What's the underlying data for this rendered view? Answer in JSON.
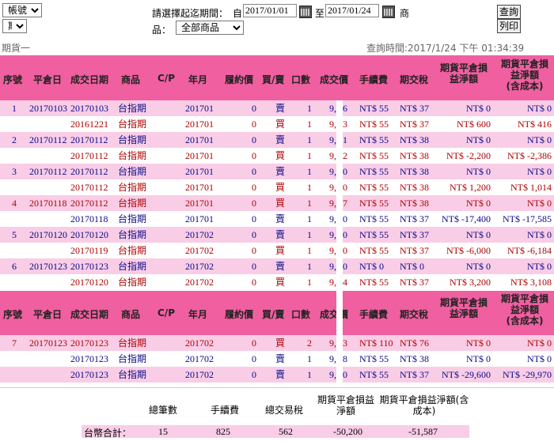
{
  "controls": {
    "account_select": "帳號",
    "type_select": "期貨-",
    "period_label": "請選擇起迄期間：",
    "from_label": "自",
    "from_date": "2017/01/01",
    "to_label": "至",
    "to_date": "2017/01/24",
    "product_label_1": "商",
    "product_label_2": "品：",
    "product_select": "全部商品",
    "query_button": "查詢",
    "print_button": "列印"
  },
  "subheader": {
    "section": "期貨一",
    "query_time": "查詢時間:2017/1/24 下午 01:34:39"
  },
  "columns": {
    "seq": "序號",
    "close_date": "平倉日",
    "trade_date": "成交日期",
    "product": "商品",
    "cp": "C/P",
    "month": "年月",
    "strike": "履約價",
    "side": "買/賣",
    "qty": "口數",
    "price": "成交價",
    "fee": "手續費",
    "tax": "期交稅",
    "pnl_net_1": "期貨平倉損",
    "pnl_net_2": "益淨額",
    "pnl_cost_1": "期貨平倉損",
    "pnl_cost_2": "益淨額",
    "pnl_cost_3": "(含成本)"
  },
  "rows1": [
    {
      "seq": "1",
      "close": "20170103",
      "date": "20170103",
      "product": "台指期",
      "month": "201701",
      "strike": "0",
      "side": "賣",
      "qty": "1",
      "price": "9,",
      "price2": "6",
      "fee": "NT$ 55",
      "tax": "NT$ 37",
      "net": "NT$ 0",
      "cost": "NT$ 0",
      "color": "blue"
    },
    {
      "seq": "",
      "close": "",
      "date": "20161221",
      "product": "台指期",
      "month": "201701",
      "strike": "0",
      "side": "買",
      "qty": "1",
      "price": "9,",
      "price2": "3",
      "fee": "NT$ 55",
      "tax": "NT$ 37",
      "net": "NT$ 600",
      "cost": "NT$ 416",
      "color": "red"
    },
    {
      "seq": "2",
      "close": "20170112",
      "date": "20170112",
      "product": "台指期",
      "month": "201701",
      "strike": "0",
      "side": "賣",
      "qty": "1",
      "price": "9,",
      "price2": "1",
      "fee": "NT$ 55",
      "tax": "NT$ 38",
      "net": "NT$ 0",
      "cost": "NT$ 0",
      "color": "blue"
    },
    {
      "seq": "",
      "close": "",
      "date": "20170112",
      "product": "台指期",
      "month": "201701",
      "strike": "0",
      "side": "買",
      "qty": "1",
      "price": "9,",
      "price2": "2",
      "fee": "NT$ 55",
      "tax": "NT$ 38",
      "net": "NT$ -2,200",
      "cost": "NT$ -2,386",
      "color": "red"
    },
    {
      "seq": "3",
      "close": "20170112",
      "date": "20170112",
      "product": "台指期",
      "month": "201701",
      "strike": "0",
      "side": "賣",
      "qty": "1",
      "price": "9,",
      "price2": "0",
      "fee": "NT$ 55",
      "tax": "NT$ 38",
      "net": "NT$ 0",
      "cost": "NT$ 0",
      "color": "blue"
    },
    {
      "seq": "",
      "close": "",
      "date": "20170112",
      "product": "台指期",
      "month": "201701",
      "strike": "0",
      "side": "買",
      "qty": "1",
      "price": "9,",
      "price2": "0",
      "fee": "NT$ 55",
      "tax": "NT$ 38",
      "net": "NT$ 1,200",
      "cost": "NT$ 1,014",
      "color": "red"
    },
    {
      "seq": "4",
      "close": "20170118",
      "date": "20170112",
      "product": "台指期",
      "month": "201701",
      "strike": "0",
      "side": "買",
      "qty": "1",
      "price": "9,",
      "price2": "7",
      "fee": "NT$ 55",
      "tax": "NT$ 38",
      "net": "NT$ 0",
      "cost": "NT$ 0",
      "color": "red"
    },
    {
      "seq": "",
      "close": "",
      "date": "20170118",
      "product": "台指期",
      "month": "201701",
      "strike": "0",
      "side": "賣",
      "qty": "1",
      "price": "9,",
      "price2": "0",
      "fee": "NT$ 55",
      "tax": "NT$ 37",
      "net": "NT$ -17,400",
      "cost": "NT$ -17,585",
      "color": "blue"
    },
    {
      "seq": "5",
      "close": "20170120",
      "date": "20170120",
      "product": "台指期",
      "month": "201702",
      "strike": "0",
      "side": "賣",
      "qty": "1",
      "price": "9,",
      "price2": "0",
      "fee": "NT$ 55",
      "tax": "NT$ 37",
      "net": "NT$ 0",
      "cost": "NT$ 0",
      "color": "blue"
    },
    {
      "seq": "",
      "close": "",
      "date": "20170119",
      "product": "台指期",
      "month": "201702",
      "strike": "0",
      "side": "買",
      "qty": "1",
      "price": "9,",
      "price2": "0",
      "fee": "NT$ 55",
      "tax": "NT$ 37",
      "net": "NT$ -6,000",
      "cost": "NT$ -6,184",
      "color": "red"
    },
    {
      "seq": "6",
      "close": "20170123",
      "date": "20170123",
      "product": "台指期",
      "month": "201702",
      "strike": "0",
      "side": "賣",
      "qty": "1",
      "price": "9,",
      "price2": "0",
      "fee": "NT$ 0",
      "tax": "NT$ 0",
      "net": "NT$ 0",
      "cost": "NT$ 0",
      "color": "blue"
    },
    {
      "seq": "",
      "close": "",
      "date": "20170120",
      "product": "台指期",
      "month": "201702",
      "strike": "0",
      "side": "買",
      "qty": "1",
      "price": "9,",
      "price2": "4",
      "fee": "NT$ 55",
      "tax": "NT$ 37",
      "net": "NT$ 3,200",
      "cost": "NT$ 3,108",
      "color": "red"
    }
  ],
  "rows2": [
    {
      "seq": "7",
      "close": "20170123",
      "date": "20170123",
      "product": "台指期",
      "month": "201702",
      "strike": "0",
      "side": "買",
      "qty": "2",
      "price": "9,",
      "price2": "3",
      "fee": "NT$ 110",
      "tax": "NT$ 76",
      "net": "NT$ 0",
      "cost": "NT$ 0",
      "color": "red"
    },
    {
      "seq": "",
      "close": "",
      "date": "20170123",
      "product": "台指期",
      "month": "201702",
      "strike": "0",
      "side": "賣",
      "qty": "1",
      "price": "9,",
      "price2": "8",
      "fee": "NT$ 55",
      "tax": "NT$ 38",
      "net": "NT$ 0",
      "cost": "NT$ 0",
      "color": "blue"
    },
    {
      "seq": "",
      "close": "",
      "date": "20170123",
      "product": "台指期",
      "month": "201702",
      "strike": "0",
      "side": "賣",
      "qty": "1",
      "price": "9,",
      "price2": "0",
      "fee": "NT$ 55",
      "tax": "NT$ 37",
      "net": "NT$ -29,600",
      "cost": "NT$ -29,970",
      "color": "blue"
    }
  ],
  "summary": {
    "h_count": "總筆數",
    "h_fee": "手續費",
    "h_tax": "總交易稅",
    "h_net_1": "期貨平倉損益",
    "h_net_2": "淨額",
    "h_cost_1": "期貨平倉損益淨額(含",
    "h_cost_2": "成本)",
    "label": "台幣合計：",
    "count": "15",
    "fee": "825",
    "tax": "562",
    "net": "-50,200",
    "cost": "-51,587"
  }
}
